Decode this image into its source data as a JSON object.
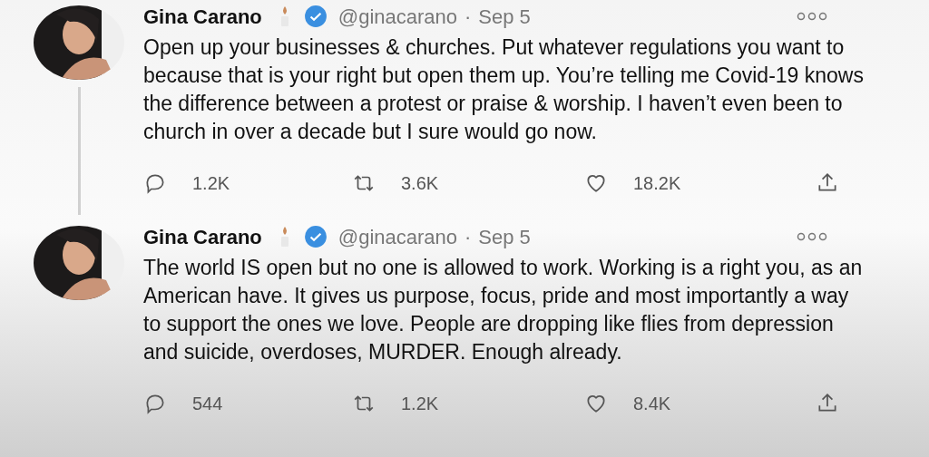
{
  "tweets": [
    {
      "name": "Gina Carano",
      "handle": "@ginacarano",
      "separator": "·",
      "date": "Sep 5",
      "text": "Open up your businesses & churches. Put whatever regulations you want to because that is your right but open them up. You’re telling me Covid-19 knows the difference between a protest or praise & worship. I haven’t even been to church in over a decade but I sure would go now.",
      "replies": "1.2K",
      "retweets": "3.6K",
      "likes": "18.2K"
    },
    {
      "name": "Gina Carano",
      "handle": "@ginacarano",
      "separator": "·",
      "date": "Sep 5",
      "text": "The world IS open but no one is allowed to work. Working is a right you, as an American have. It gives us purpose, focus, pride and most importantly a way to support the ones we love. People are dropping like flies from depression and suicide, overdoses, MURDER. Enough already.",
      "replies": "544",
      "retweets": "1.2K",
      "likes": "8.4K"
    }
  ]
}
